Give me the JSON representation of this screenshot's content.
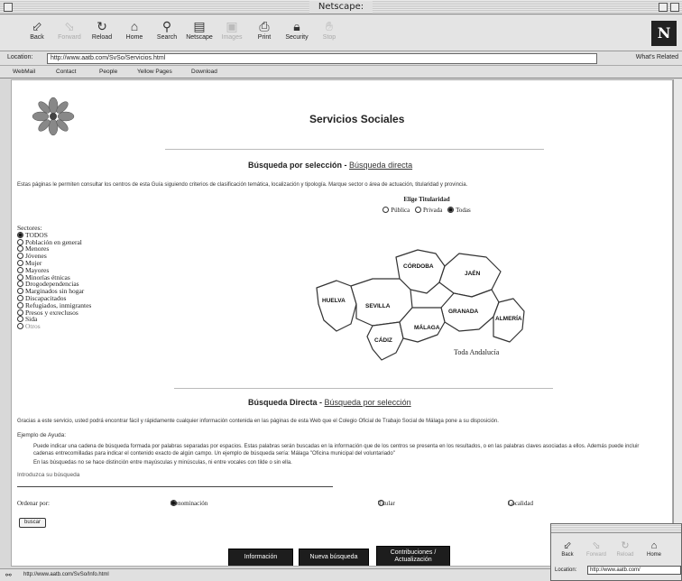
{
  "window": {
    "title": "Netscape:"
  },
  "toolbar": {
    "buttons": [
      {
        "label": "Back",
        "icon": "back-arrow-icon"
      },
      {
        "label": "Forward",
        "icon": "forward-arrow-icon"
      },
      {
        "label": "Reload",
        "icon": "reload-icon"
      },
      {
        "label": "Home",
        "icon": "home-icon"
      },
      {
        "label": "Search",
        "icon": "search-icon"
      },
      {
        "label": "Netscape",
        "icon": "netscape-icon"
      },
      {
        "label": "Images",
        "icon": "images-icon"
      },
      {
        "label": "Print",
        "icon": "print-icon"
      },
      {
        "label": "Security",
        "icon": "security-icon"
      },
      {
        "label": "Stop",
        "icon": "stop-icon"
      }
    ],
    "logo": "N"
  },
  "location": {
    "label": "Location:",
    "url": "http://www.aatb.com/SvSo/Servicios.html",
    "whats_related": "What's Related"
  },
  "personal_toolbar": {
    "items": [
      "WebMail",
      "Contact",
      "People",
      "Yellow Pages",
      "Download"
    ]
  },
  "page": {
    "title": "Servicios Sociales",
    "seleccion": {
      "heading": "Búsqueda por selección",
      "link": "Búsqueda directa",
      "intro": "Estas páginas le permiten consultar los centros de esta Guía siguiendo criterios de clasificación temática, localización y tipología. Marque sector o área de actuación, titularidad y provincia."
    },
    "titularidad": {
      "label": "Elige Titularidad",
      "options": [
        "Pública",
        "Privada",
        "Todas"
      ],
      "selected": "Todas"
    },
    "sectores": {
      "label": "Sectores:",
      "items": [
        "TODOS",
        "Población en general",
        "Menores",
        "Jóvenes",
        "Mujer",
        "Mayores",
        "Minorías étnicas",
        "Drogodependencias",
        "Marginados sin hogar",
        "Discapacitados",
        "Refugiados, inmigrantes",
        "Presos y exreclusos",
        "Sida",
        "Otros"
      ],
      "selected": "TODOS"
    },
    "map": {
      "provinces": [
        "CÓRDOBA",
        "JAÉN",
        "HUELVA",
        "SEVILLA",
        "GRANADA",
        "ALMERÍA",
        "CÁDIZ",
        "MÁLAGA"
      ],
      "all_label": "Toda Andalucía"
    },
    "directa": {
      "heading": "Búsqueda Directa",
      "link": "Búsqueda por selección",
      "intro": "Gracias a este servicio, usted podrá encontrar fácil y rápidamente cualquier información contenida en las páginas de esta Web que el Colegio Oficial de Trabajo Social de Málaga pone a su disposición.",
      "ayuda_label": "Ejemplo de Ayuda:",
      "ayuda_text": "Puede indicar una cadena de búsqueda formada por palabras separadas por espacios. Estas palabras serán buscadas en la información que de los centros se presenta en los resultados, o en las palabras claves asociadas a ellos. Además puede incluir cadenas entrecomilladas para indicar el contenido exacto de algún campo. Un ejemplo de búsqueda sería: Málaga \"Oficina municipal del voluntariado\"",
      "ayuda_note": "En las búsquedas no se hace distinción entre mayúsculas y minúsculas, ni entre vocales con tilde o sin ella.",
      "input_label": "Introduzca su búsqueda",
      "input_value": "",
      "ordenar_label": "Ordenar por:",
      "ordenar_options": [
        "Denominación",
        "Titular",
        "Localidad"
      ],
      "ordenar_selected": "Denominación",
      "buscar_button": "buscar"
    },
    "bottom_buttons": [
      "Información",
      "Nueva búsqueda",
      "Contribuciones / Actualización"
    ]
  },
  "status": {
    "text": "http://www.aatb.com/SvSo/Info.html"
  },
  "second_window": {
    "buttons": [
      "Back",
      "Forward",
      "Reload",
      "Home"
    ],
    "location_label": "Location:",
    "url": "http://www.aatb.com/"
  }
}
